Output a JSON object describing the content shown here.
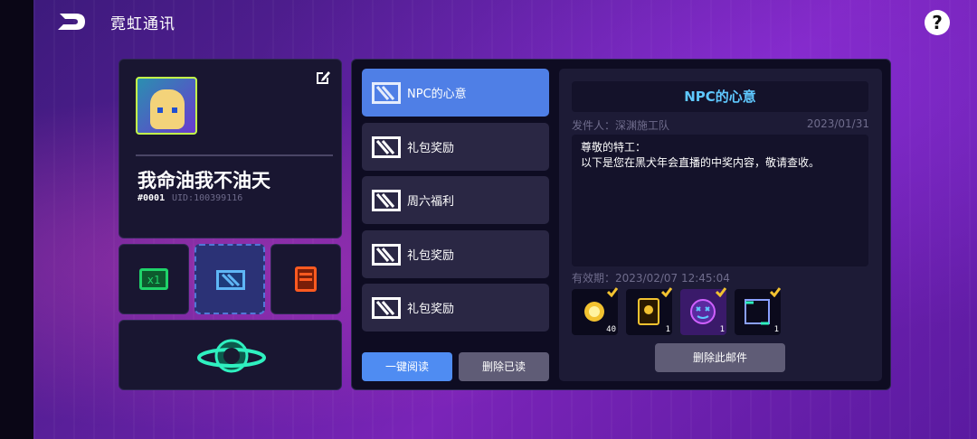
{
  "header": {
    "title": "霓虹通讯",
    "help_label": "?"
  },
  "profile": {
    "name": "我命油我不油天",
    "id": "#0001",
    "uid": "UID:100399116"
  },
  "mail_list": [
    {
      "label": "NPC的心意",
      "active": true
    },
    {
      "label": "礼包奖励",
      "active": false
    },
    {
      "label": "周六福利",
      "active": false
    },
    {
      "label": "礼包奖励",
      "active": false
    },
    {
      "label": "礼包奖励",
      "active": false
    }
  ],
  "actions": {
    "read_all": "一键阅读",
    "delete_read": "删除已读"
  },
  "detail": {
    "title": "NPC的心意",
    "sender": "发件人：深渊施工队",
    "date": "2023/01/31",
    "body_line1": "尊敬的特工：",
    "body_line2": "以下是您在黑犬年会直播的中奖内容，敬请查收。",
    "expiry": "有效期：2023/02/07 12:45:04",
    "rewards": [
      {
        "icon": "gold-gem-icon",
        "qty": "40"
      },
      {
        "icon": "weapon-card-icon",
        "qty": "1"
      },
      {
        "icon": "emoji-face-icon",
        "qty": "1"
      },
      {
        "icon": "frame-icon",
        "qty": "1"
      }
    ],
    "delete_label": "删除此邮件"
  },
  "colors": {
    "accent": "#4f7fe6",
    "title_cyan": "#5fc8ff",
    "check": "#f2c230"
  }
}
